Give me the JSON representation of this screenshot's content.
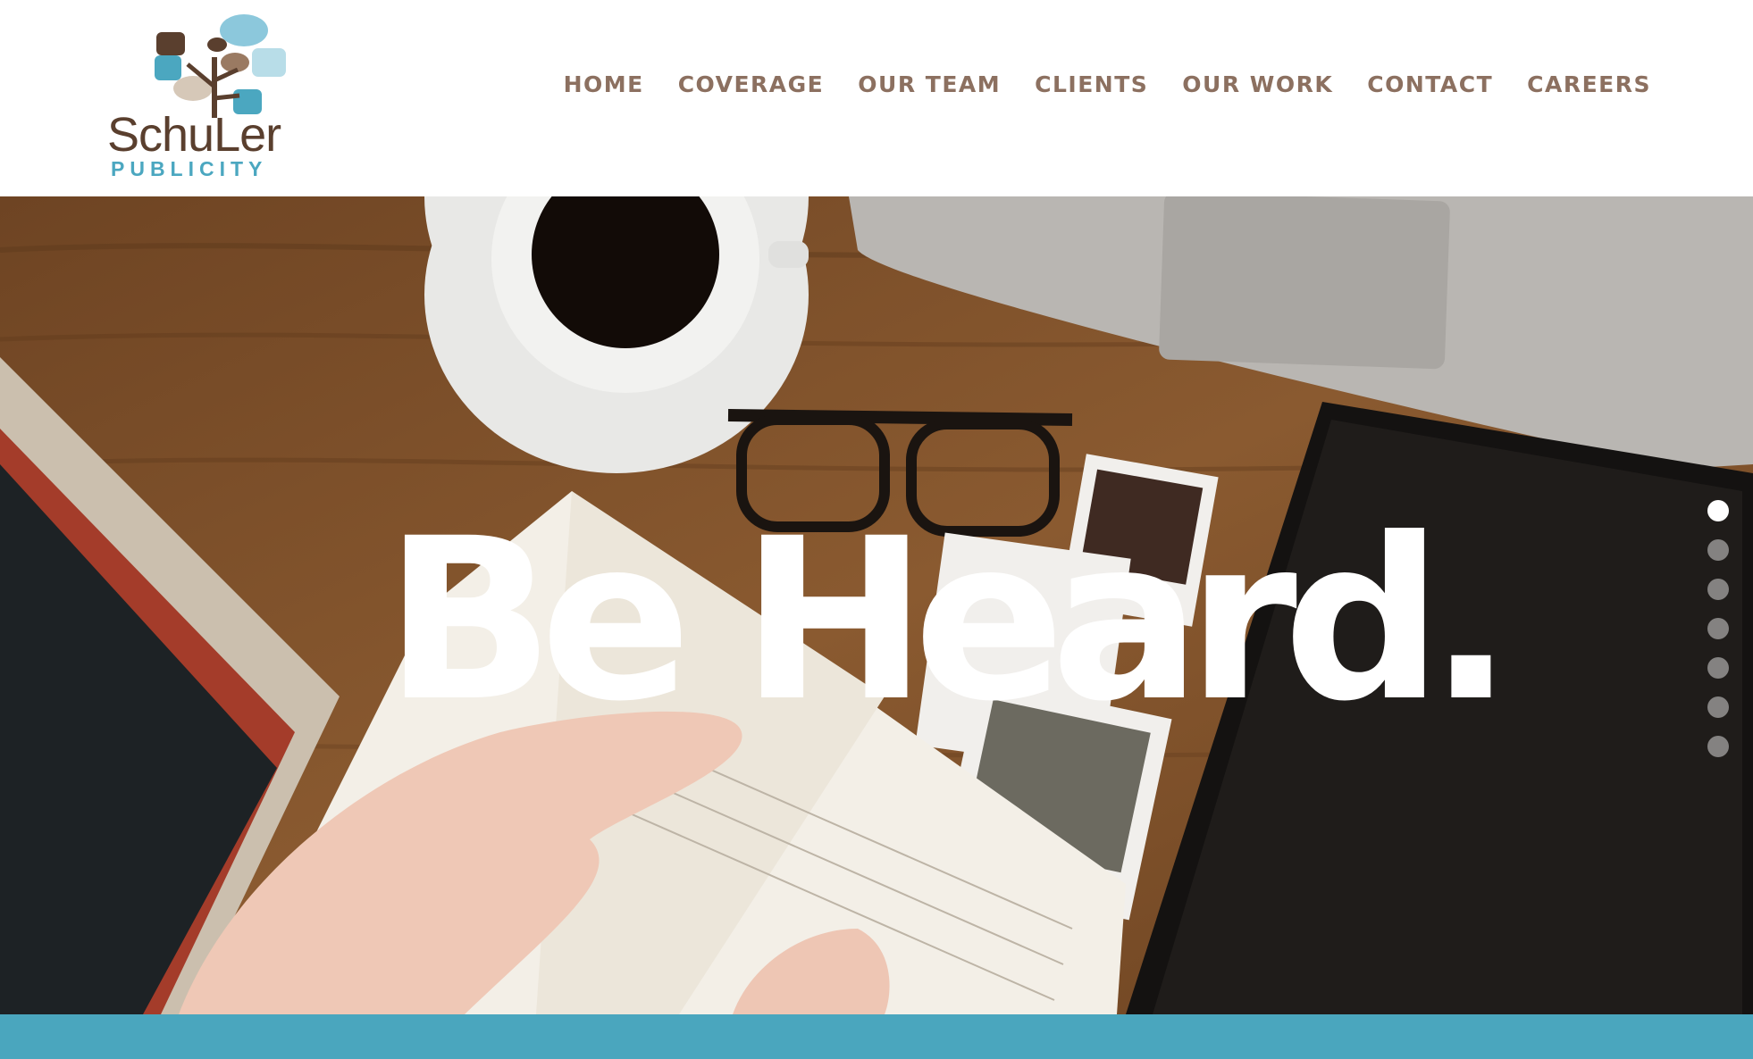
{
  "brand": {
    "name": "SchuLer",
    "tagline": "PUBLICITY"
  },
  "nav": {
    "items": [
      {
        "label": "HOME"
      },
      {
        "label": "COVERAGE"
      },
      {
        "label": "OUR TEAM"
      },
      {
        "label": "CLIENTS"
      },
      {
        "label": "OUR WORK"
      },
      {
        "label": "CONTACT"
      },
      {
        "label": "CAREERS"
      }
    ]
  },
  "hero": {
    "headline": "Be Heard.",
    "slides_total": 7,
    "active_slide": 1
  },
  "colors": {
    "accent_blue": "#4aa6be",
    "nav_text": "#8c7060",
    "logo_brown": "#5a3f2e",
    "headline": "#ffffff"
  }
}
